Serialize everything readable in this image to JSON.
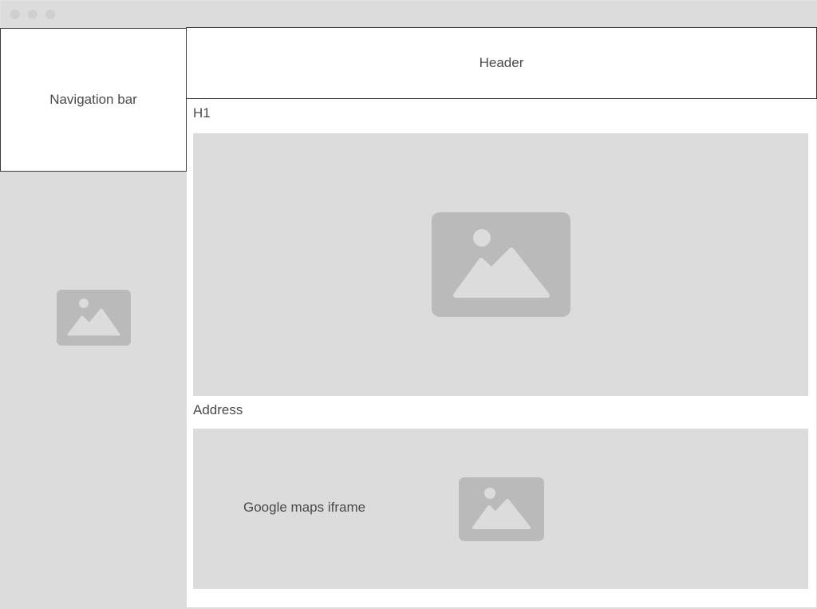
{
  "navigation": {
    "label": "Navigation bar"
  },
  "header": {
    "label": "Header"
  },
  "content": {
    "h1": "H1",
    "address_label": "Address",
    "map_label": "Google maps iframe"
  },
  "icons": {
    "placeholder": "image-placeholder-icon"
  },
  "colors": {
    "placeholder_bg": "#dcdcdc",
    "icon_fill": "#bababa",
    "border": "#3a3a3a",
    "text": "#4a4a4a"
  }
}
